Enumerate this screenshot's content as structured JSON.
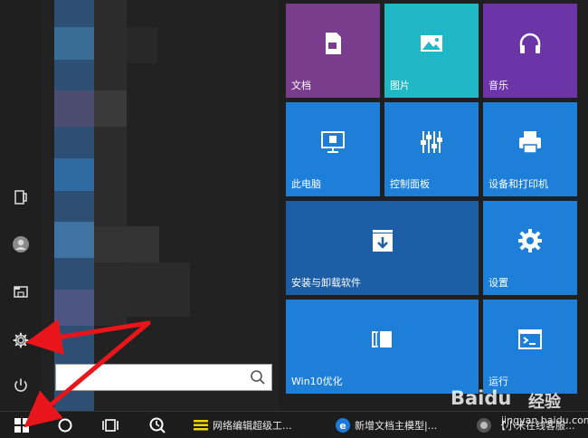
{
  "tiles": {
    "documents": {
      "label": "文档",
      "icon": "document-icon"
    },
    "pictures": {
      "label": "图片",
      "icon": "picture-icon"
    },
    "music": {
      "label": "音乐",
      "icon": "headphones-icon"
    },
    "this_pc": {
      "label": "此电脑",
      "icon": "monitor-icon"
    },
    "control_panel": {
      "label": "控制面板",
      "icon": "sliders-icon"
    },
    "devices_printers": {
      "label": "设备和打印机",
      "icon": "printer-icon"
    },
    "install_uninstall": {
      "label": "安装与卸载软件",
      "icon": "download-box-icon"
    },
    "settings": {
      "label": "设置",
      "icon": "gear-icon"
    },
    "win10_optimize": {
      "label": "Win10优化",
      "icon": "panel-icon"
    },
    "terminal": {
      "label": "运行",
      "icon": "terminal-icon"
    }
  },
  "search": {
    "placeholder": ""
  },
  "taskbar": {
    "app1": {
      "label": "网络编辑超级工...",
      "icon": "editor-icon"
    },
    "app2": {
      "label": "新增文档主模型|...",
      "icon": "ie-icon"
    },
    "app3": {
      "label": "【小米在线客服...",
      "icon": "browser-icon"
    }
  },
  "watermark": {
    "brand": "Baidu",
    "suffix": "经验",
    "url": "jingyan.baidu.com"
  },
  "colors": {
    "purple_tile": "#7a3c8c",
    "teal_tile": "#20b7c6",
    "violet_tile": "#6b35a8",
    "blue_tile": "#1e7fd8",
    "darkblue_tile": "#1d5fa6",
    "arrow": "#e8161b"
  }
}
